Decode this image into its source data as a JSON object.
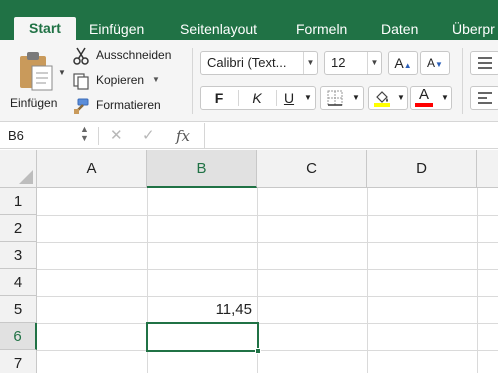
{
  "tabs": [
    "Start",
    "Einfügen",
    "Seitenlayout",
    "Formeln",
    "Daten",
    "Überpr"
  ],
  "ribbon": {
    "paste_label": "Einfügen",
    "cut_label": "Ausschneiden",
    "copy_label": "Kopieren",
    "format_painter_label": "Formatieren",
    "font_name": "Calibri (Text...",
    "font_size": "12",
    "bold_label": "F",
    "italic_label": "K",
    "underline_label": "U",
    "increase_font_label": "A",
    "decrease_font_label": "A"
  },
  "formula_bar": {
    "name_box": "B6",
    "fx_label": "fx",
    "formula": ""
  },
  "grid": {
    "columns": [
      "A",
      "B",
      "C",
      "D"
    ],
    "rows": [
      "1",
      "2",
      "3",
      "4",
      "5",
      "6",
      "7"
    ],
    "selected_column": "B",
    "selected_row": "6",
    "cells": {
      "B5": "11,45"
    }
  },
  "colors": {
    "accent": "#207245",
    "fill_swatch": "#ffff00",
    "font_color_swatch": "#ff0000"
  },
  "icons": [
    "paste-icon",
    "scissors-icon",
    "copy-icon",
    "format-painter-icon",
    "cancel-icon",
    "confirm-icon",
    "fx-icon",
    "fill-bucket-icon",
    "borders-icon",
    "align-icon"
  ]
}
